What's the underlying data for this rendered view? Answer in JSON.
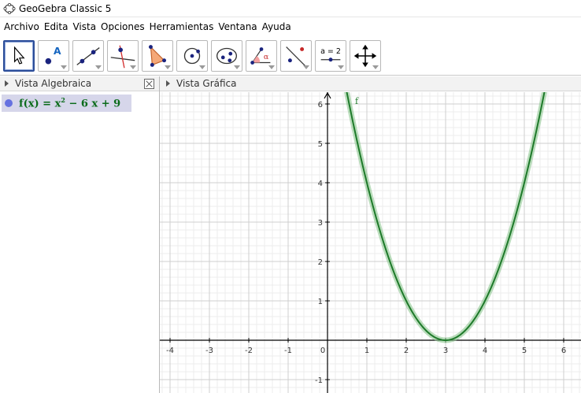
{
  "window": {
    "title": "GeoGebra Classic 5"
  },
  "menu": [
    "Archivo",
    "Edita",
    "Vista",
    "Opciones",
    "Herramientas",
    "Ventana",
    "Ayuda"
  ],
  "toolbar": {
    "tools": [
      {
        "name": "move-tool",
        "selected": true
      },
      {
        "name": "point-tool"
      },
      {
        "name": "line-tool"
      },
      {
        "name": "perpendicular-line-tool"
      },
      {
        "name": "polygon-tool"
      },
      {
        "name": "circle-center-point-tool"
      },
      {
        "name": "ellipse-tool"
      },
      {
        "name": "angle-tool"
      },
      {
        "name": "reflect-tool"
      },
      {
        "name": "slider-tool",
        "label": "a = 2"
      },
      {
        "name": "move-graphics-view-tool"
      }
    ]
  },
  "algebra_view": {
    "title": "Vista Algebraica",
    "object": {
      "lhs": "f(x) = x",
      "exp": "2",
      "rhs": " − 6 x + 9",
      "color": "#0a6b1a",
      "dot_color": "#6671e0"
    }
  },
  "graphics_view": {
    "title": "Vista Gráfica",
    "function_label": "f",
    "curve_color": "#1e7a2a",
    "curve_glow": "#8cc68f"
  },
  "chart_data": {
    "type": "line",
    "title": "",
    "series": [
      {
        "name": "f",
        "expression": "x^2 - 6x + 9"
      }
    ],
    "x_ticks": [
      "-4",
      "-3",
      "-2",
      "-1",
      "0",
      "1",
      "2",
      "3",
      "4",
      "5",
      "6"
    ],
    "y_ticks": [
      "-1",
      "1",
      "2",
      "3",
      "4",
      "5",
      "6"
    ],
    "xlim": [
      -4.3,
      6.4
    ],
    "ylim": [
      -1.3,
      6.3
    ],
    "grid": true
  }
}
